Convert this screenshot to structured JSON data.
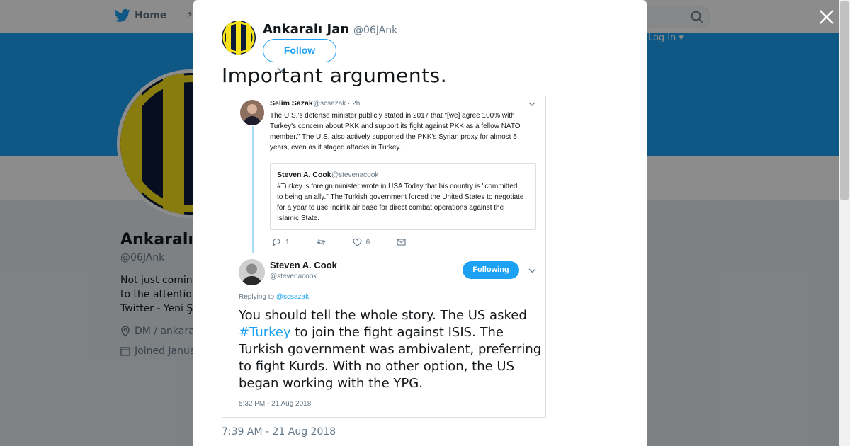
{
  "background": {
    "nav": {
      "home_label": "Home",
      "login_label": "Log in ▾"
    },
    "profile": {
      "name": "Ankaralı",
      "handle": "@06JAnk",
      "bio_lines": [
        "Not just comin",
        "to the attention",
        "Twitter - Yeni Ş"
      ],
      "location": "DM / ankara",
      "joined": "Joined Janua"
    }
  },
  "modal": {
    "author": {
      "name": "Ankaralı Jan",
      "handle": "@06JAnk",
      "follow_label": "Follow"
    },
    "tweet_text": "Important arguments.",
    "timestamp": "7:39 AM - 21 Aug 2018",
    "embedded": {
      "top_tweet": {
        "name": "Selim Sazak",
        "handle": "@scsazak · 2h",
        "text": "The U.S.'s defense minister publicly stated in 2017 that \"[we] agree 100% with Turkey's concern about PKK and support its fight against PKK as a fellow NATO member.\" The U.S. also actively supported the PKK's Syrian proxy for almost 5 years, even as it staged attacks in Turkey.",
        "quote": {
          "name": "Steven A. Cook",
          "handle": "@stevenacook",
          "text": "#Turkey 's foreign minister wrote in USA Today that his country is \"committed to being an ally.\" The Turkish government forced the United States to negotiate for a year to use Incirlik air base for direct combat operations against the Islamic State."
        },
        "reply_count": "1",
        "like_count": "6"
      },
      "main_tweet": {
        "name": "Steven A. Cook",
        "handle": "@stevenacook",
        "following_label": "Following",
        "replying_prefix": "Replying to ",
        "replying_to": "@scsazak",
        "text_before": "You should tell the whole story.  The US asked ",
        "hashtag": "#Turkey",
        "text_after": " to join the fight against ISIS.  The Turkish government was ambivalent, preferring to fight Kurds.  With no other option, the US began working with the YPG.",
        "time": "5:32 PM - 21 Aug 2018"
      }
    }
  },
  "colors": {
    "brand_blue": "#1da1f2",
    "banner": "#1da1f2",
    "text": "#14171a",
    "muted": "#657786"
  }
}
